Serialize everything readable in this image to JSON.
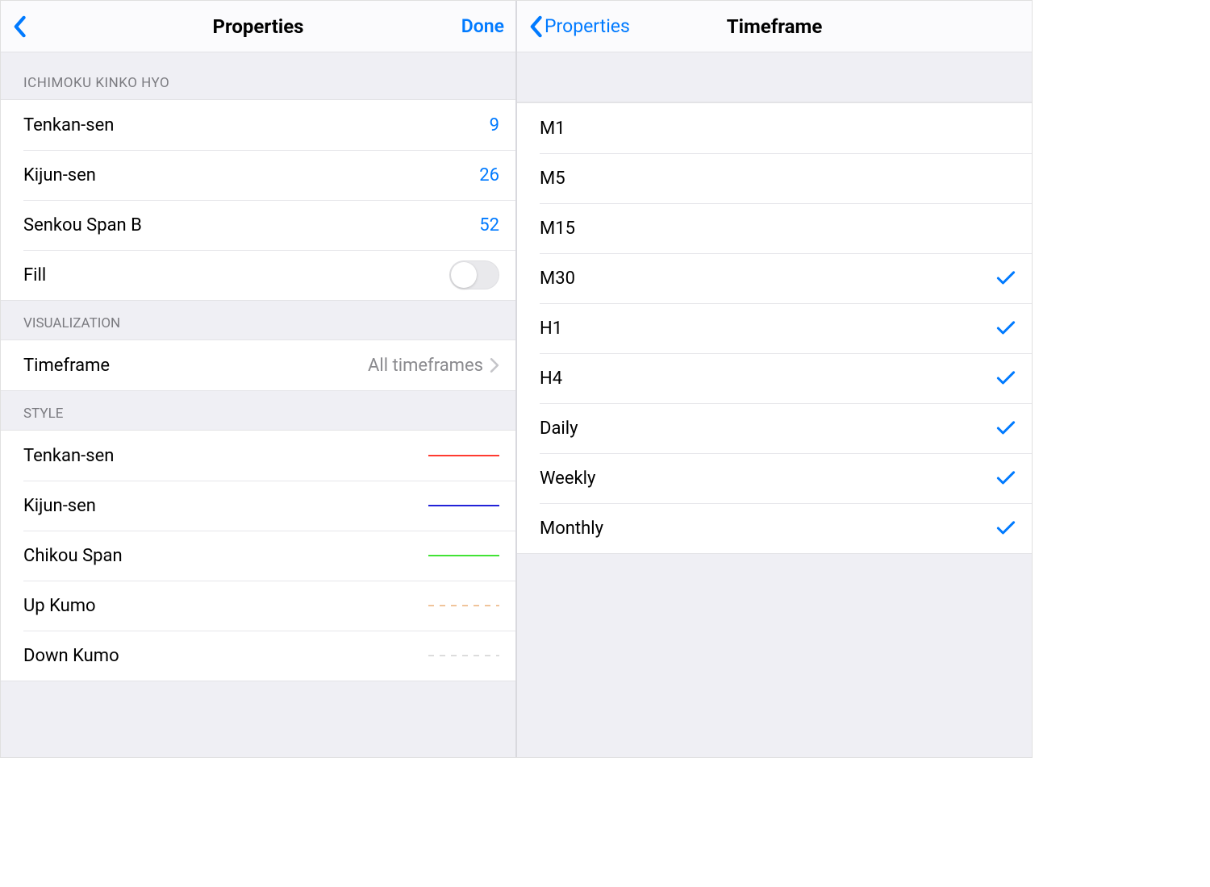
{
  "left": {
    "nav": {
      "title": "Properties",
      "done": "Done"
    },
    "section_ichimoku": {
      "header": "ICHIMOKU KINKO HYO",
      "tenkan_label": "Tenkan-sen",
      "tenkan_value": "9",
      "kijun_label": "Kijun-sen",
      "kijun_value": "26",
      "senkou_label": "Senkou Span B",
      "senkou_value": "52",
      "fill_label": "Fill"
    },
    "section_visualization": {
      "header": "VISUALIZATION",
      "timeframe_label": "Timeframe",
      "timeframe_value": "All timeframes"
    },
    "section_style": {
      "header": "STYLE",
      "tenkan_label": "Tenkan-sen",
      "kijun_label": "Kijun-sen",
      "chikou_label": "Chikou Span",
      "upkumo_label": "Up Kumo",
      "downkumo_label": "Down Kumo"
    }
  },
  "right": {
    "nav": {
      "back_text": "Properties",
      "title": "Timeframe"
    },
    "items": [
      {
        "label": "M1",
        "checked": false
      },
      {
        "label": "M5",
        "checked": false
      },
      {
        "label": "M15",
        "checked": false
      },
      {
        "label": "M30",
        "checked": true
      },
      {
        "label": "H1",
        "checked": true
      },
      {
        "label": "H4",
        "checked": true
      },
      {
        "label": "Daily",
        "checked": true
      },
      {
        "label": "Weekly",
        "checked": true
      },
      {
        "label": "Monthly",
        "checked": true
      }
    ]
  }
}
